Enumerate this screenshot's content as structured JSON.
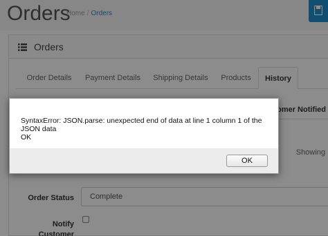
{
  "header": {
    "title": "Orders",
    "breadcrumb": [
      {
        "label": "Home"
      },
      {
        "label": "Orders"
      }
    ],
    "breadcrumb_separator": "/",
    "accent_color": "#1e91cf"
  },
  "panel": {
    "icon": "list-icon",
    "title": "Orders"
  },
  "tabs": [
    {
      "label": "Order Details",
      "active": false
    },
    {
      "label": "Payment Details",
      "active": false
    },
    {
      "label": "Shipping Details",
      "active": false
    },
    {
      "label": "Products",
      "active": false
    },
    {
      "label": "History",
      "active": true
    }
  ],
  "history_table": {
    "visible_header": "tomer Notified",
    "footer_text": "Showing"
  },
  "form": {
    "order_status_label": "Order Status",
    "order_status_value": "Complete",
    "notify_label_line1": "Notify",
    "notify_label_line2": "Customer",
    "notify_checked": false
  },
  "dialog": {
    "message_line1": "SyntaxError: JSON.parse: unexpected end of data at line 1 column 1 of the JSON data",
    "message_line2": "OK",
    "ok_button": "OK"
  }
}
